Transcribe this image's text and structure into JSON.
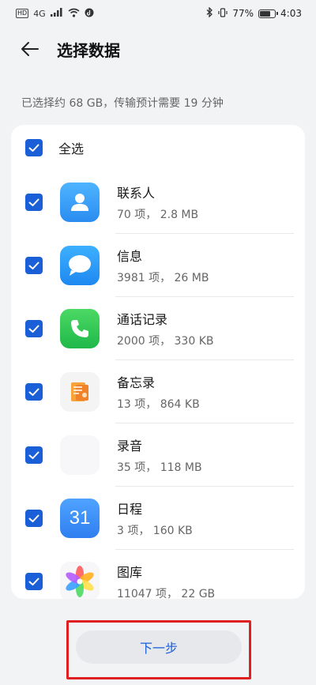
{
  "status_bar": {
    "hd_label": "HD",
    "signal_label": "4G",
    "battery_percent": "77%",
    "battery_level": 0.77,
    "time": "4:03"
  },
  "header": {
    "title": "选择数据"
  },
  "summary_text": "已选择约 68 GB，传输预计需要 19 分钟",
  "select_all": {
    "label": "全选",
    "checked": true
  },
  "items": [
    {
      "name": "联系人",
      "meta": "70 项， 2.8 MB",
      "icon": "contacts-icon",
      "checked": true
    },
    {
      "name": "信息",
      "meta": "3981 项， 26 MB",
      "icon": "messages-icon",
      "checked": true
    },
    {
      "name": "通话记录",
      "meta": "2000 项， 330 KB",
      "icon": "phone-icon",
      "checked": true
    },
    {
      "name": "备忘录",
      "meta": "13 项， 864 KB",
      "icon": "notes-icon",
      "checked": true
    },
    {
      "name": "录音",
      "meta": "35 项， 118 MB",
      "icon": "recorder-icon",
      "checked": true
    },
    {
      "name": "日程",
      "meta": "3 项， 160 KB",
      "icon": "calendar-icon",
      "checked": true,
      "icon_text": "31"
    },
    {
      "name": "图库",
      "meta": "11047 项， 22 GB",
      "icon": "gallery-icon",
      "checked": true
    }
  ],
  "footer": {
    "next_label": "下一步"
  },
  "colors": {
    "accent": "#1a5fd8",
    "highlight": "#e02020",
    "background": "#f1f3f5"
  }
}
